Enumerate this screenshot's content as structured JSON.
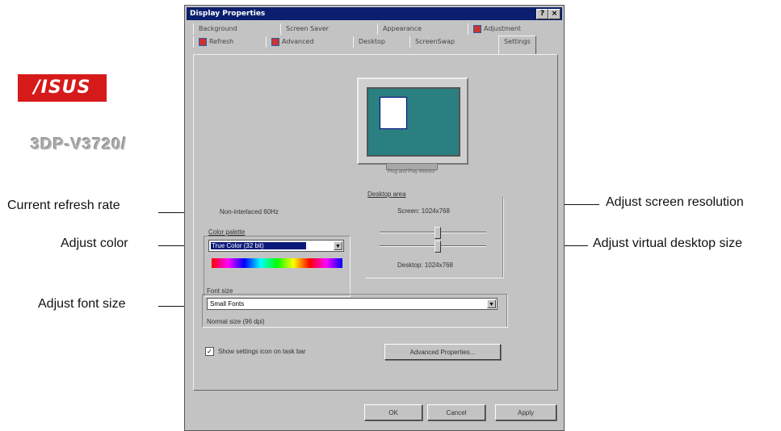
{
  "dialog": {
    "title": "Display Properties",
    "title_buttons": [
      "?",
      "×"
    ],
    "tabs_row1": [
      "Background",
      "Screen Saver",
      "Appearance",
      "Adjustment"
    ],
    "tabs_row2": [
      "Refresh",
      "Advanced",
      "Desktop",
      "ScreenSwap",
      "Settings"
    ],
    "active_tab": "Settings"
  },
  "brand": {
    "logo_text": "/ISUS",
    "chip_name": "3DP-V3720/"
  },
  "settings": {
    "refresh_rate": "Non-interlaced 60Hz",
    "color_palette_label": "Color palette",
    "color_palette_value": "True Color (32 bit)",
    "desktop_area_label": "Desktop area",
    "screen_value": "Screen: 1024x768",
    "desktop_value": "Desktop: 1024x768",
    "resolution_slider_fraction": 0.55,
    "virtual_slider_fraction": 0.55,
    "font_size_label": "Font size",
    "font_size_value": "Small Fonts",
    "font_note": "Normal size (96 dpi)",
    "taskbar_checkbox_label": "Show settings icon on task bar",
    "taskbar_checkbox_checked": true,
    "advanced_button": "Advanced Properties...",
    "monitor_caption": "Plug and Play Monitor"
  },
  "buttons": {
    "ok": "OK",
    "cancel": "Cancel",
    "apply": "Apply"
  },
  "callouts": {
    "refresh": "Current refresh rate",
    "color": "Adjust color",
    "font": "Adjust font size",
    "resolution": "Adjust screen resolution",
    "virtual": "Adjust virtual desktop size"
  }
}
